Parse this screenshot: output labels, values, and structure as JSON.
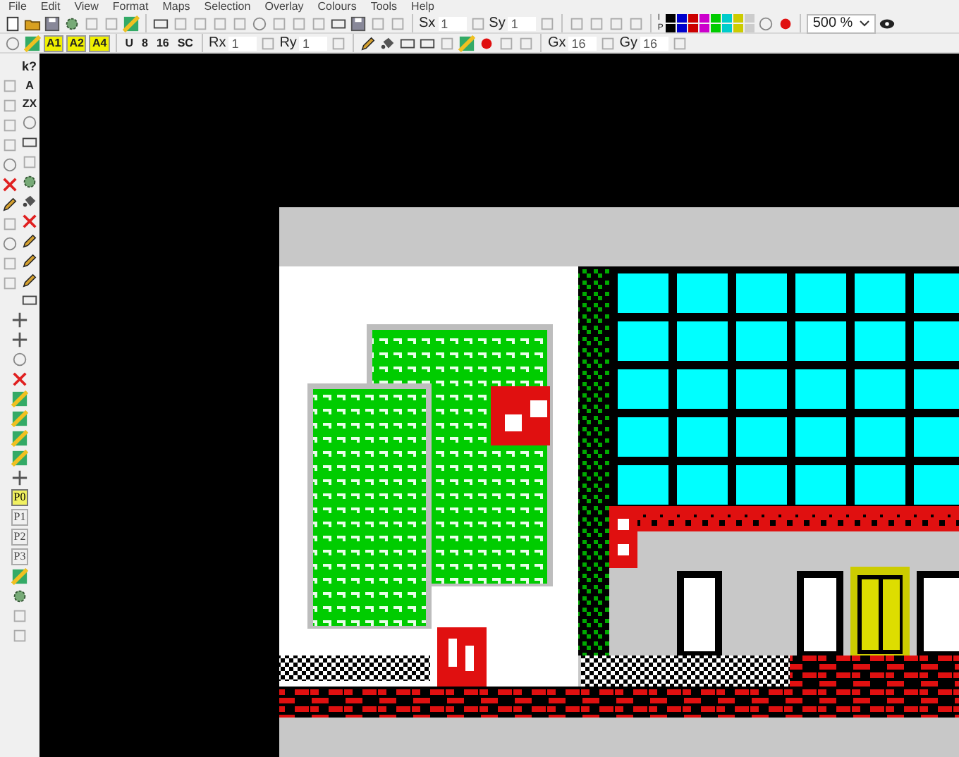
{
  "menu_bar": [
    "File",
    "Edit",
    "View",
    "Format",
    "Maps",
    "Selection",
    "Overlay",
    "Colours",
    "Tools",
    "Help"
  ],
  "toolbar_1": {
    "sx": {
      "label": "Sx",
      "value": "1"
    },
    "sy": {
      "label": "Sy",
      "value": "1"
    },
    "palette": {
      "ink_label": "I",
      "paper_label": "P",
      "colors": [
        {
          "color": "#000000"
        },
        {
          "color": "#0000cc"
        },
        {
          "color": "#cc0000"
        },
        {
          "color": "#cc00cc"
        },
        {
          "color": "#00cc00"
        },
        {
          "color": "#00cccc"
        },
        {
          "color": "#cccc00"
        },
        {
          "color": "#cccccc"
        }
      ]
    },
    "zoom": "500 %"
  },
  "toolbar_2": {
    "attr_buttons": [
      "A1",
      "A2",
      "A4"
    ],
    "mode_buttons": [
      "U",
      "8",
      "16",
      "SC"
    ],
    "rx": {
      "label": "Rx",
      "value": "1"
    },
    "ry": {
      "label": "Ry",
      "value": "1"
    },
    "gx": {
      "label": "Gx",
      "value": "16"
    },
    "gy": {
      "label": "Gy",
      "value": "16"
    }
  },
  "toolbox": {
    "help_button": "k?",
    "text_tools": [
      "A",
      "ZX"
    ],
    "plane_buttons": [
      {
        "label": "P0",
        "selected": true
      },
      {
        "label": "P1",
        "selected": false
      },
      {
        "label": "P2",
        "selected": false
      },
      {
        "label": "P3",
        "selected": false
      }
    ]
  }
}
